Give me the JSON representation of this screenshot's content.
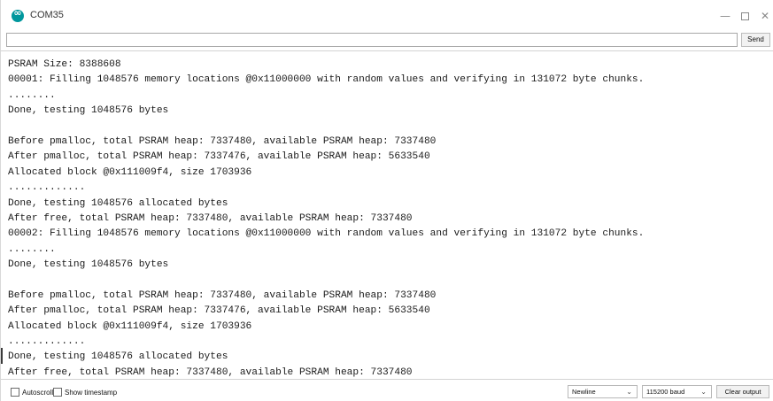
{
  "window": {
    "title": "COM35",
    "minimize_glyph": "—",
    "close_glyph": "✕"
  },
  "send_bar": {
    "input_value": "",
    "send_label": "Send"
  },
  "output_lines": [
    "PSRAM Size: 8388608",
    "00001: Filling 1048576 memory locations @0x11000000 with random values and verifying in 131072 byte chunks.",
    "........",
    "Done, testing 1048576 bytes",
    "",
    "Before pmalloc, total PSRAM heap: 7337480, available PSRAM heap: 7337480",
    "After pmalloc, total PSRAM heap: 7337476, available PSRAM heap: 5633540",
    "Allocated block @0x111009f4, size 1703936",
    ".............",
    "Done, testing 1048576 allocated bytes",
    "After free, total PSRAM heap: 7337480, available PSRAM heap: 7337480",
    "00002: Filling 1048576 memory locations @0x11000000 with random values and verifying in 131072 byte chunks.",
    "........",
    "Done, testing 1048576 bytes",
    "",
    "Before pmalloc, total PSRAM heap: 7337480, available PSRAM heap: 7337480",
    "After pmalloc, total PSRAM heap: 7337476, available PSRAM heap: 5633540",
    "Allocated block @0x111009f4, size 1703936",
    ".............",
    "Done, testing 1048576 allocated bytes",
    "After free, total PSRAM heap: 7337480, available PSRAM heap: 7337480"
  ],
  "bottom_bar": {
    "autoscroll_label": "Autoscroll",
    "autoscroll_checked": false,
    "timestamp_label": "Show timestamp",
    "timestamp_checked": false,
    "line_ending_selected": "Newline",
    "baud_selected": "115200 baud",
    "clear_label": "Clear output"
  },
  "icons": {
    "app": "arduino-icon",
    "dropdown": "chevron-down-icon"
  },
  "colors": {
    "app_icon": "#00979d",
    "text": "#1a1a1a",
    "border": "#d4d4d4"
  }
}
